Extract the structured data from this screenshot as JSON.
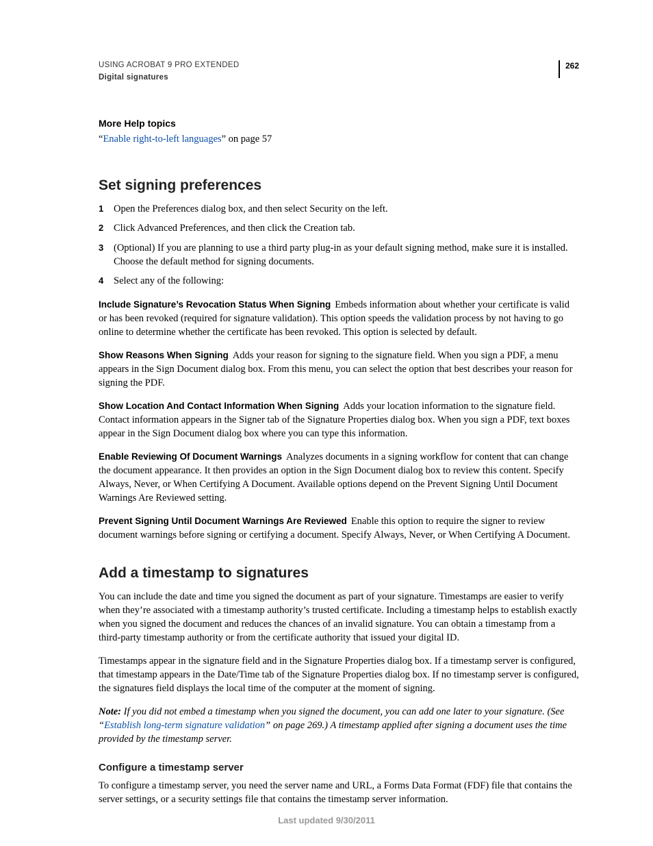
{
  "header": {
    "title": "USING ACROBAT 9 PRO EXTENDED",
    "section": "Digital signatures",
    "pageNumber": "262"
  },
  "moreHelp": {
    "heading": "More Help topics",
    "quoteOpen": "“",
    "linkText": "Enable right-to-left languages",
    "quoteClose": "” on page 57"
  },
  "sec1": {
    "heading": "Set signing preferences",
    "steps": [
      "Open the Preferences dialog box, and then select Security on the left.",
      "Click Advanced Preferences, and then click the Creation tab.",
      "(Optional) If you are planning to use a third party plug-in as your default signing method, make sure it is installed. Choose the default method for signing documents.",
      "Select any of the following:"
    ],
    "defs": [
      {
        "term": "Include Signature’s Revocation Status When Signing",
        "text": "Embeds information about whether your certificate is valid or has been revoked (required for signature validation). This option speeds the validation process by not having to go online to determine whether the certificate has been revoked. This option is selected by default."
      },
      {
        "term": "Show Reasons When Signing",
        "text": "Adds your reason for signing to the signature field. When you sign a PDF, a menu appears in the Sign Document dialog box. From this menu, you can select the option that best describes your reason for signing the PDF."
      },
      {
        "term": "Show Location And Contact Information When Signing",
        "text": "Adds your location information to the signature field. Contact information appears in the Signer tab of the Signature Properties dialog box. When you sign a PDF, text boxes appear in the Sign Document dialog box where you can type this information."
      },
      {
        "term": "Enable Reviewing Of Document Warnings",
        "text": "Analyzes documents in a signing workflow for content that can change the document appearance. It then provides an option in the Sign Document dialog box to review this content. Specify Always, Never, or When Certifying A Document. Available options depend on the Prevent Signing Until Document Warnings Are Reviewed setting."
      },
      {
        "term": "Prevent Signing Until Document Warnings Are Reviewed",
        "text": "Enable this option to require the signer to review document warnings before signing or certifying a document. Specify Always, Never, or When Certifying A Document."
      }
    ]
  },
  "sec2": {
    "heading": "Add a timestamp to signatures",
    "p1": "You can include the date and time you signed the document as part of your signature. Timestamps are easier to verify when they’re associated with a timestamp authority’s trusted certificate. Including a timestamp helps to establish exactly when you signed the document and reduces the chances of an invalid signature. You can obtain a timestamp from a third-party timestamp authority or from the certificate authority that issued your digital ID.",
    "p2": "Timestamps appear in the signature field and in the Signature Properties dialog box. If a timestamp server is configured, that timestamp appears in the Date/Time tab of the Signature Properties dialog box. If no timestamp server is configured, the signatures field displays the local time of the computer at the moment of signing.",
    "noteLabel": "Note:",
    "notePre": " If you did not embed a timestamp when you signed the document, you can add one later to your signature. (See “",
    "noteLink": "Establish long-term signature validation",
    "notePost": "” on page 269.) A timestamp applied after signing a document uses the time provided by the timestamp server.",
    "sub": {
      "heading": "Configure a timestamp server",
      "p": "To configure a timestamp server, you need the server name and URL, a Forms Data Format (FDF) file that contains the server settings, or a security settings file that contains the timestamp server information."
    }
  },
  "footer": "Last updated 9/30/2011"
}
